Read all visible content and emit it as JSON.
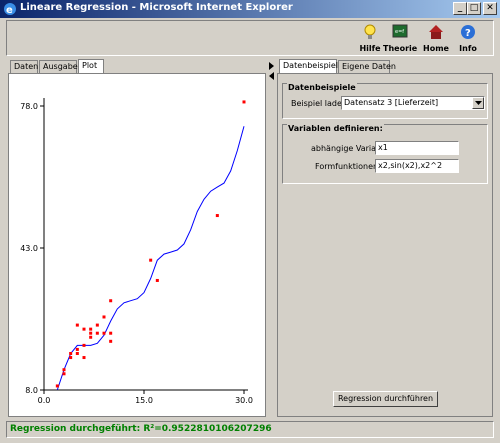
{
  "window": {
    "title": "Lineare Regression - Microsoft Internet Explorer",
    "min": "_",
    "max": "□",
    "close": "✕"
  },
  "toolbar": [
    {
      "label": "Hilfe",
      "icon": "lightbulb-icon"
    },
    {
      "label": "Theorie",
      "icon": "chalkboard-icon"
    },
    {
      "label": "Home",
      "icon": "home-icon"
    },
    {
      "label": "Info",
      "icon": "info-icon"
    }
  ],
  "left_tabs": [
    "Daten",
    "Ausgabe",
    "Plot"
  ],
  "left_active_tab": "Plot",
  "right_tabs": [
    "Datenbeispiele",
    "Eigene Daten"
  ],
  "right_active_tab": "Datenbeispiele",
  "datenbeispiele": {
    "legend": "Datenbeispiele",
    "load_label": "Beispiel laden",
    "selected": "Datensatz 3 [Lieferzeit]"
  },
  "variablen": {
    "legend": "Variablen definieren:",
    "dep_label": "abhängige Variable",
    "dep_value": "x1",
    "form_label": "Formfunktionen",
    "form_value": "x2,sin(x2),x2^2"
  },
  "run_button": "Regression durchführen",
  "status": "Regression durchgeführt: R²=0.9522810106207296",
  "colors": {
    "points": "#ff0000",
    "fit": "#0000ff",
    "status": "#008000",
    "titlebar": "#0a246a"
  },
  "chart_data": {
    "type": "scatter",
    "x_ticks": [
      "0.0",
      "15.0",
      "30.0"
    ],
    "y_ticks": [
      "8.0",
      "43.0",
      "78.0"
    ],
    "xlim": [
      0,
      30
    ],
    "ylim": [
      8,
      78
    ],
    "series": [
      {
        "kind": "points",
        "x": [
          2,
          3,
          3,
          4,
          4,
          5,
          5,
          5,
          6,
          6,
          6,
          7,
          7,
          7,
          8,
          8,
          9,
          9,
          10,
          10,
          10,
          16,
          17,
          26,
          30
        ],
        "y": [
          9,
          13,
          12,
          16,
          17,
          24,
          18,
          17,
          19,
          23,
          16,
          23,
          21,
          22,
          22,
          24,
          22,
          26,
          20,
          22,
          30,
          40,
          35,
          51,
          79
        ]
      },
      {
        "kind": "fit",
        "x": [
          2,
          3,
          4,
          5,
          6,
          7,
          8,
          9,
          10,
          11,
          12,
          13,
          14,
          15,
          16,
          17,
          18,
          19,
          20,
          21,
          22,
          23,
          24,
          25,
          26,
          27,
          28,
          29,
          30
        ],
        "y": [
          8,
          13,
          17,
          19,
          19,
          19,
          19.5,
          21.5,
          25,
          28,
          29.5,
          30,
          30.5,
          32,
          35.5,
          40,
          41.5,
          42,
          42.5,
          44,
          47.5,
          52,
          55,
          57,
          58,
          59,
          62,
          67,
          73
        ]
      }
    ]
  }
}
